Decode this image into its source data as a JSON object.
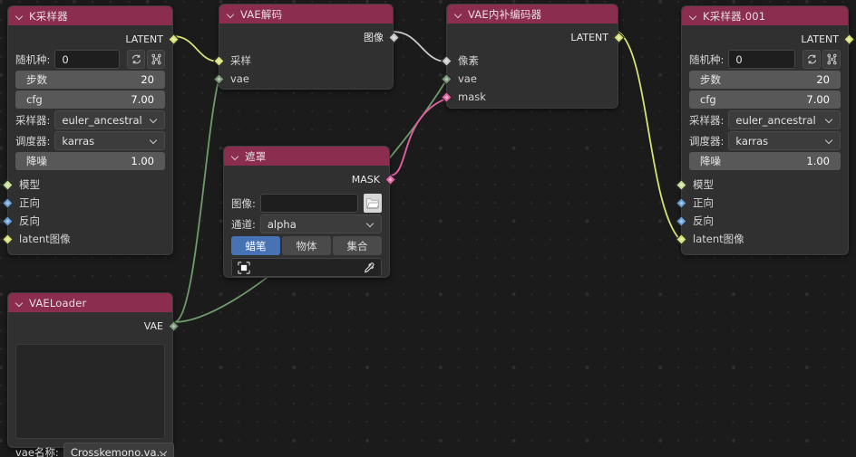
{
  "app": {
    "background_color": "#1b1b1b",
    "header_color": "#8a2d4e"
  },
  "socket_colors": {
    "latent": "#d8e07a",
    "model": "#c8dd9a",
    "conditioning": "#6a9fd8",
    "image": "#c8c8c8",
    "vae": "#7a9a78",
    "mask": "#e06aa8"
  },
  "nodes": [
    {
      "id": "ksampler",
      "title": "K采样器",
      "outputs": [
        {
          "label": "LATENT",
          "type": "latent"
        }
      ],
      "widgets": {
        "seed_label": "随机种:",
        "seed_value": "0",
        "steps_label": "步数",
        "steps_value": "20",
        "cfg_label": "cfg",
        "cfg_value": "7.00",
        "sampler_label": "采样器:",
        "sampler_value": "euler_ancestral",
        "scheduler_label": "调度器:",
        "scheduler_value": "karras",
        "denoise_label": "降噪",
        "denoise_value": "1.00"
      },
      "inputs": [
        {
          "label": "模型",
          "type": "model"
        },
        {
          "label": "正向",
          "type": "conditioning"
        },
        {
          "label": "反向",
          "type": "conditioning"
        },
        {
          "label": "latent图像",
          "type": "latent"
        }
      ]
    },
    {
      "id": "vaedecode",
      "title": "VAE解码",
      "outputs": [
        {
          "label": "图像",
          "type": "image"
        }
      ],
      "inputs": [
        {
          "label": "采样",
          "type": "latent"
        },
        {
          "label": "vae",
          "type": "vae"
        }
      ]
    },
    {
      "id": "vaeencodeinpaint",
      "title": "VAE内补编码器",
      "outputs": [
        {
          "label": "LATENT",
          "type": "latent"
        }
      ],
      "inputs": [
        {
          "label": "像素",
          "type": "image"
        },
        {
          "label": "vae",
          "type": "vae"
        },
        {
          "label": "mask",
          "type": "mask"
        }
      ]
    },
    {
      "id": "ksampler001",
      "title": "K采样器.001",
      "outputs": [
        {
          "label": "LATENT",
          "type": "latent"
        }
      ],
      "widgets": {
        "seed_label": "随机种:",
        "seed_value": "0",
        "steps_label": "步数",
        "steps_value": "20",
        "cfg_label": "cfg",
        "cfg_value": "7.00",
        "sampler_label": "采样器:",
        "sampler_value": "euler_ancestral",
        "scheduler_label": "调度器:",
        "scheduler_value": "karras",
        "denoise_label": "降噪",
        "denoise_value": "1.00"
      },
      "inputs": [
        {
          "label": "模型",
          "type": "model"
        },
        {
          "label": "正向",
          "type": "conditioning"
        },
        {
          "label": "反向",
          "type": "conditioning"
        },
        {
          "label": "latent图像",
          "type": "latent"
        }
      ]
    },
    {
      "id": "mask",
      "title": "遮罩",
      "outputs": [
        {
          "label": "MASK",
          "type": "mask"
        }
      ],
      "widgets": {
        "image_label": "图像:",
        "image_value": "",
        "channel_label": "通道:",
        "channel_value": "alpha",
        "tabs": [
          "蜡笔",
          "物体",
          "集合"
        ],
        "active_tab": "蜡笔"
      }
    },
    {
      "id": "vaeloader",
      "title": "VAELoader",
      "outputs": [
        {
          "label": "VAE",
          "type": "vae"
        }
      ],
      "widgets": {
        "vae_name_label": "vae名称:",
        "vae_name_value": "Crosskemono.va..."
      }
    }
  ],
  "icons": {
    "collapse": "chevron-down-icon",
    "refresh": "refresh-seed-icon",
    "randomize": "randomize-seed-icon",
    "folder": "folder-open-icon",
    "eyedropper": "eyedropper-icon",
    "colorswatch": "color-swatch-icon"
  }
}
